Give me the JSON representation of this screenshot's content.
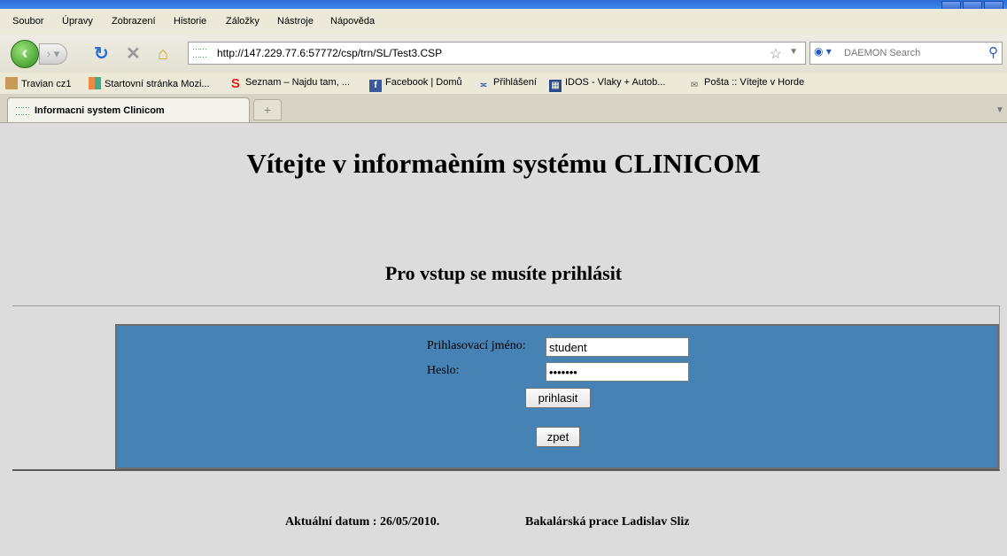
{
  "browser": {
    "menu": [
      "Soubor",
      "Úpravy",
      "Zobrazení",
      "Historie",
      "Záložky",
      "Nástroje",
      "Nápověda"
    ],
    "url": "http://147.229.77.6:57772/csp/trn/SL/Test3.CSP",
    "search_placeholder": "DAEMON Search",
    "bookmarks": [
      "Travian cz1",
      "Startovní stránka Mozi...",
      "Seznam – Najdu tam, ...",
      "Facebook | Domů",
      "Přihlášení",
      "IDOS - Vlaky + Autob...",
      "Pošta :: Vítejte v Horde"
    ],
    "tab_title": "Informacni system Clinicom"
  },
  "page": {
    "heading": "Vítejte v informaèním systému CLINICOM",
    "subheading": "Pro vstup se musíte prihlásit",
    "login": {
      "username_label": "Prihlasovací jméno:",
      "username_value": "student",
      "password_label": "Heslo:",
      "password_value": "student",
      "login_button": "prihlasit",
      "back_button": "zpet"
    },
    "footer": {
      "date_text": "Aktuální datum : 26/05/2010.",
      "author_text": "Bakalárská prace Ladislav Sliz"
    }
  },
  "colors": {
    "login_panel": "#4682b4",
    "page_background": "#dcdcdc"
  }
}
